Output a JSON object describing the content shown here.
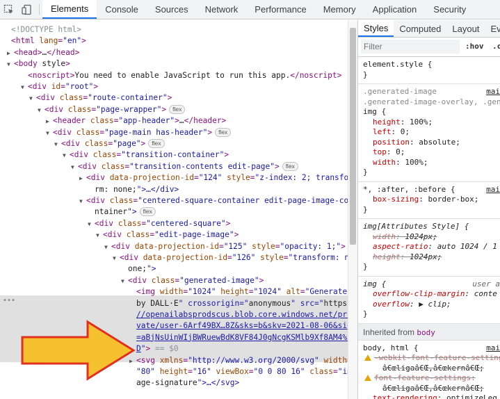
{
  "toolbar": {
    "tabs": [
      "Elements",
      "Console",
      "Sources",
      "Network",
      "Performance",
      "Memory",
      "Application",
      "Security"
    ],
    "active_tab": "Elements",
    "icons": [
      "inspect-icon",
      "device-toggle-icon"
    ]
  },
  "elements": {
    "lines": [
      {
        "t": "<!DOCTYPE html>"
      },
      {
        "t": "<html lang=\"en\">"
      },
      {
        "t": "<head>…</head>"
      },
      {
        "t": "<body style>"
      },
      {
        "t": "<noscript>You need to enable JavaScript to run this app.</noscript>"
      },
      {
        "t": "<div id=\"root\">"
      },
      {
        "t": "<div class=\"route-container\">"
      },
      {
        "t": "<div class=\"page-wrapper\">",
        "badge": "flex"
      },
      {
        "t": "<header class=\"app-header\">…</header>"
      },
      {
        "t": "<div class=\"page-main has-header\">",
        "badge": "flex"
      },
      {
        "t": "<div class=\"page\">",
        "badge": "flex"
      },
      {
        "t": "<div class=\"transition-container\">"
      },
      {
        "t": "<div class=\"transition-contents edit-page\">",
        "badge": "flex"
      },
      {
        "t": "<div data-projection-id=\"124\" style=\"z-index: 2; transfo"
      },
      {
        "t": "rm: none;\">…</div>"
      },
      {
        "t": "<div class=\"centered-square-container edit-page-image-co"
      },
      {
        "t": "ntainer\">",
        "badge": "flex"
      },
      {
        "t": "<div class=\"centered-square\">"
      },
      {
        "t": "<div class=\"edit-page-image\">"
      },
      {
        "t": "<div data-projection-id=\"125\" style=\"opacity: 1;\">"
      },
      {
        "t": "<div data-projection-id=\"126\" style=\"transform: n"
      },
      {
        "t": "one;\">"
      },
      {
        "t": "<div class=\"generated-image\">"
      },
      {
        "t": "<img width=\"1024\" height=\"1024\" alt=\"Generated"
      },
      {
        "t": "by DALL·E\" crossorigin=\"anonymous\" src=\"https:"
      },
      {
        "t": "//openailabsprodscus.blob.core.windows.net/pri"
      },
      {
        "t": "vate/user-6Arf49BX…8Z&sks=b&skv=2021-08-06&sig"
      },
      {
        "t": "=aBjNsUinWIjBWRuewBdK8VF84J0gNcgKSMlb9Xf8AM4%3"
      },
      {
        "t": "D\"> == $0"
      },
      {
        "t": "<svg xmlns=\"http://www.w3.org/2000/svg\" width="
      },
      {
        "t": "\"80\" height=\"16\" viewBox=\"0 0 80 16\" class=\"im"
      },
      {
        "t": "age-signature\">…</svg>"
      }
    ],
    "ellipsis": "•••"
  },
  "styles": {
    "tabs": [
      "Styles",
      "Computed",
      "Layout",
      "Ev"
    ],
    "active_tab": "Styles",
    "filter_placeholder": "Filter",
    "hov": ":hov",
    "cls": ".c",
    "element_style": "element.style {",
    "rule1": {
      "selector1": ".generated-image",
      "selector2": ".generated-image-overlay, .gen",
      "selector3": "img {",
      "source": "mai",
      "props": [
        {
          "n": "height",
          "v": "100%;"
        },
        {
          "n": "left",
          "v": "0;"
        },
        {
          "n": "position",
          "v": "absolute;"
        },
        {
          "n": "top",
          "v": "0;"
        },
        {
          "n": "width",
          "v": "100%;"
        }
      ]
    },
    "rule2": {
      "selector": "*, :after, :before {",
      "source": "mai",
      "props": [
        {
          "n": "box-sizing",
          "v": "border-box;"
        }
      ]
    },
    "rule3": {
      "selector": "img[Attributes Style] {",
      "props": [
        {
          "n": "width",
          "v": "1024px;",
          "strike": true
        },
        {
          "n": "aspect-ratio",
          "v": "auto 1024 / 1"
        },
        {
          "n": "height",
          "v": "1024px;",
          "strike": true
        }
      ]
    },
    "rule4": {
      "selector": "img {",
      "source": "user a",
      "props": [
        {
          "n": "overflow-clip-margin",
          "v": "conte"
        },
        {
          "n": "overflow",
          "v": "▶ clip;"
        }
      ]
    },
    "inherited_label": "Inherited from",
    "inherited_tag": "body",
    "rule5": {
      "selector": "body, html {",
      "source": "mai",
      "props": [
        {
          "n": "-webkit-font-feature-setting",
          "v": "",
          "strike": true,
          "warn": true
        },
        {
          "n": "",
          "v": "â€œligaâ€Œ,â€œkernâ€Œ;",
          "strike": true,
          "indent": true
        },
        {
          "n": "font-feature-settings",
          "v": "",
          "strike": true,
          "warn": true
        },
        {
          "n": "",
          "v": "â€œligaâ€Œ,â€œkernâ€Œ;",
          "strike": true,
          "indent": true
        },
        {
          "n": "text-rendering",
          "v": "optimizeLeg"
        },
        {
          "n": "-webkit-font-smoothing",
          "v": "ant"
        }
      ]
    },
    "close": "}"
  },
  "colors": {
    "arrow_fill": "#f5c12e",
    "arrow_stroke": "#e03020",
    "accent": "#1a73e8"
  }
}
